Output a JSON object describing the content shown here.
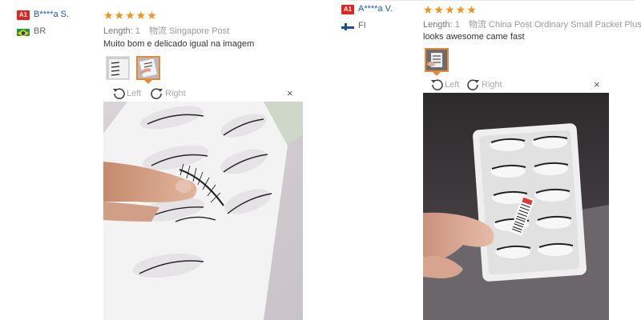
{
  "reviews": [
    {
      "badge": "A1",
      "name": "B****a S.",
      "country": "BR",
      "stars": "★★★★★",
      "length_label": "Length:",
      "length_value": "1",
      "shipping_cn": "物流",
      "shipping": "Singapore Post",
      "text": "Muito bom e delicado igual na imagem",
      "rotate_left": "Left",
      "rotate_right": "Right",
      "close": "×"
    },
    {
      "badge": "A1",
      "name": "A****a V.",
      "country": "FI",
      "stars": "★★★★★",
      "length_label": "Length:",
      "length_value": "1",
      "shipping_cn": "物流",
      "shipping": "China Post Ordinary Small Packet Plus",
      "text": "looks awesome came fast",
      "rotate_left": "Left",
      "rotate_right": "Right",
      "close": "×"
    }
  ],
  "colors": {
    "star": "#f0941a",
    "name": "#1a5aa8",
    "badge": "#e5231e",
    "thumb_selected": "#e28b32"
  }
}
